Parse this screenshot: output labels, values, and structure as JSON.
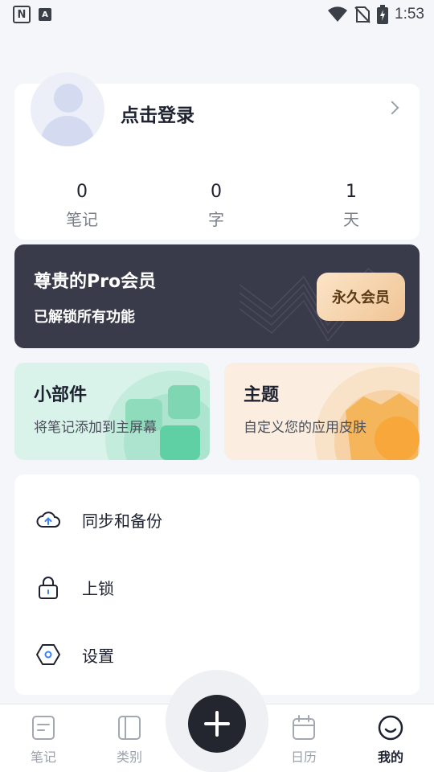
{
  "status_bar": {
    "notif_n": "N",
    "notif_a": "A",
    "time": "1:53",
    "icons": [
      "wifi-icon",
      "no-sim-icon",
      "battery-charging-icon"
    ]
  },
  "profile": {
    "login_label": "点击登录",
    "stats": [
      {
        "value": "0",
        "label": "笔记"
      },
      {
        "value": "0",
        "label": "字"
      },
      {
        "value": "1",
        "label": "天"
      }
    ]
  },
  "pro_banner": {
    "title": "尊贵的Pro会员",
    "subtitle": "已解锁所有功能",
    "button": "永久会员",
    "colors": {
      "background": "#3a3b4a",
      "button_from": "#fbe5c8",
      "button_to": "#f1c495"
    }
  },
  "tiles": {
    "widget": {
      "title": "小部件",
      "subtitle": "将笔记添加到主屏幕",
      "color": "#d9f3ea"
    },
    "theme": {
      "title": "主题",
      "subtitle": "自定义您的应用皮肤",
      "color": "#fbeee0"
    }
  },
  "menu": [
    {
      "label": "同步和备份",
      "icon": "cloud-upload-icon"
    },
    {
      "label": "上锁",
      "icon": "lock-icon"
    },
    {
      "label": "设置",
      "icon": "settings-hexagon-icon"
    }
  ],
  "bottom_nav": [
    {
      "label": "笔记",
      "icon": "notes-icon",
      "active": false
    },
    {
      "label": "类别",
      "icon": "category-icon",
      "active": false
    },
    {
      "label": "日历",
      "icon": "calendar-icon",
      "active": false
    },
    {
      "label": "我的",
      "icon": "smile-face-icon",
      "active": true
    }
  ],
  "fab": {
    "icon": "plus-icon"
  }
}
